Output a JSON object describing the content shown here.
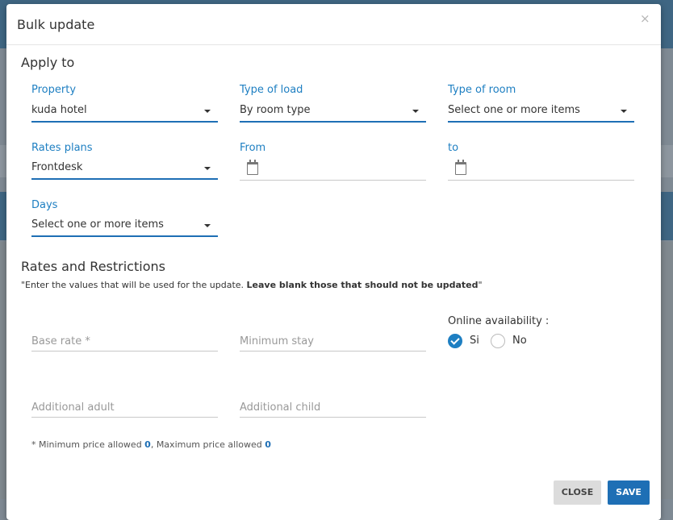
{
  "modal": {
    "title": "Bulk update",
    "close_glyph": "×"
  },
  "apply_to": {
    "title": "Apply to",
    "property": {
      "label": "Property",
      "value": "kuda hotel"
    },
    "type_of_load": {
      "label": "Type of load",
      "value": "By room type"
    },
    "type_of_room": {
      "label": "Type of room",
      "value": "Select one or more items"
    },
    "rates_plans": {
      "label": "Rates plans",
      "value": "Frontdesk"
    },
    "from": {
      "label": "From"
    },
    "to": {
      "label": "to"
    },
    "days": {
      "label": "Days",
      "value": "Select one or more items"
    }
  },
  "rates_restrictions": {
    "title": "Rates and Restrictions",
    "note_plain": "\"Enter the values that will be used for the update. ",
    "note_bold": "Leave blank those that should not be updated",
    "note_end": "\"",
    "base_rate_placeholder": "Base rate *",
    "minimum_stay_placeholder": "Minimum stay",
    "additional_adult_placeholder": "Additional adult",
    "additional_child_placeholder": "Additional child",
    "online_availability": {
      "label": "Online availability :",
      "options": [
        "Si",
        "No"
      ],
      "selected": "Si"
    },
    "footnote_a": "* Minimum price allowed ",
    "min_price": "0",
    "footnote_b": ", Maximum price allowed ",
    "max_price": "0"
  },
  "buttons": {
    "close": "CLOSE",
    "save": "SAVE"
  },
  "colors": {
    "accent": "#1e7fc2",
    "button_primary": "#1e6fb5",
    "button_secondary": "#dcdcdc"
  }
}
